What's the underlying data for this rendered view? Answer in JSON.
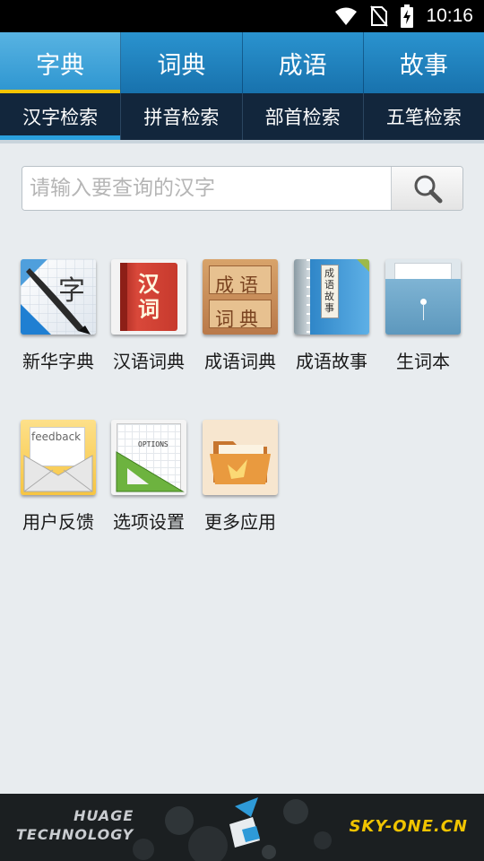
{
  "status_bar": {
    "time": "10:16"
  },
  "main_tabs": [
    {
      "label": "字典",
      "active": true
    },
    {
      "label": "词典",
      "active": false
    },
    {
      "label": "成语",
      "active": false
    },
    {
      "label": "故事",
      "active": false
    }
  ],
  "sub_tabs": [
    {
      "label": "汉字检索",
      "active": true
    },
    {
      "label": "拼音检索",
      "active": false
    },
    {
      "label": "部首检索",
      "active": false
    },
    {
      "label": "五笔检索",
      "active": false
    }
  ],
  "search": {
    "placeholder": "请输入要查询的汉字",
    "value": ""
  },
  "apps": [
    {
      "label": "新华字典",
      "icon": "xinhua-dictionary-icon",
      "icon_text": "字"
    },
    {
      "label": "汉语词典",
      "icon": "chinese-dictionary-icon",
      "icon_text": "汉词"
    },
    {
      "label": "成语词典",
      "icon": "idiom-dictionary-icon",
      "icon_text": "成语词典"
    },
    {
      "label": "成语故事",
      "icon": "idiom-story-icon",
      "icon_text": "成语故事"
    },
    {
      "label": "生词本",
      "icon": "vocabulary-folder-icon"
    },
    {
      "label": "用户反馈",
      "icon": "feedback-envelope-icon",
      "icon_text": "feedback"
    },
    {
      "label": "选项设置",
      "icon": "options-settings-icon",
      "icon_text": "OPTIONS"
    },
    {
      "label": "更多应用",
      "icon": "more-apps-folder-icon"
    }
  ],
  "footer": {
    "brand_line1": "HUAGE",
    "brand_line2": "TECHNOLOGY",
    "site": "SKY-ONE.CN"
  },
  "colors": {
    "tab_blue": "#1f86c4",
    "accent_yellow": "#f5c400",
    "subtab_bg": "#12263c"
  }
}
